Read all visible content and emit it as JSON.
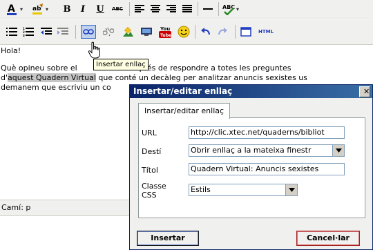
{
  "editor": {
    "toolbar1": {
      "bold": "B",
      "italic": "I",
      "underline": "U",
      "strike": "ABC"
    },
    "toolbar2": {
      "youtube": "You",
      "html": "HTML"
    },
    "content": {
      "line1": "Hola!",
      "line2_a": "Què opineu sobre el",
      "line2_b": "istes? Després de respondre a totes les preguntes",
      "line3_a": "d'",
      "line3_hl": "aquest Quadern Virtual",
      "line3_b": " que conté un decàleg per analitzar anuncis sexistes us",
      "line4": "demanem que escriviu un co"
    },
    "tooltip": "Insertar enllaç",
    "status": "Camí: p"
  },
  "dialog": {
    "title": "Insertar/editar enllaç",
    "tab": "Insertar/editar enllaç",
    "url_label": "URL",
    "url_value": "http://clic.xtec.net/quaderns/bibliot",
    "target_label": "Destí",
    "target_value": "Obrir enllaç a la mateixa finestr",
    "title_label": "Títol",
    "title_value": "Quadern Virtual: Anuncis sexistes",
    "class_label_1": "Classe",
    "class_label_2": "CSS",
    "class_value": "Estils",
    "insert_button": "Insertar",
    "cancel_button": "Cancel·lar"
  },
  "colors": {
    "accent_blue": "#0a246a",
    "cancel_border": "#a52020",
    "highlight": "#c6c6c6"
  }
}
